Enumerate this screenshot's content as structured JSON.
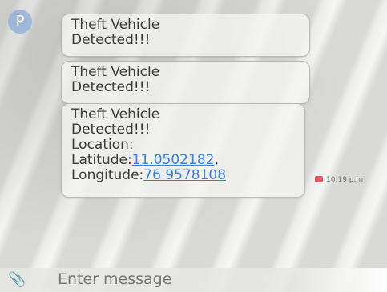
{
  "avatar": {
    "initial": "P"
  },
  "messages": [
    {
      "lines": [
        "Theft Vehicle",
        "Detected!!!"
      ]
    },
    {
      "lines": [
        "Theft Vehicle",
        "Detected!!!"
      ]
    },
    {
      "lines": [
        "Theft Vehicle",
        "Detected!!!",
        "Location:"
      ],
      "latitude_label": "Latitude:",
      "latitude_value": "11.0502182",
      "latitude_suffix": ",",
      "longitude_label": "Longitude:",
      "longitude_value": "76.9578108"
    }
  ],
  "timestamp": "10:19 p.m",
  "composer": {
    "placeholder": "Enter message"
  },
  "icons": {
    "attach": "paperclip-icon"
  },
  "colors": {
    "link": "#3c7fd6",
    "bubble_text": "#3a3a3a"
  }
}
